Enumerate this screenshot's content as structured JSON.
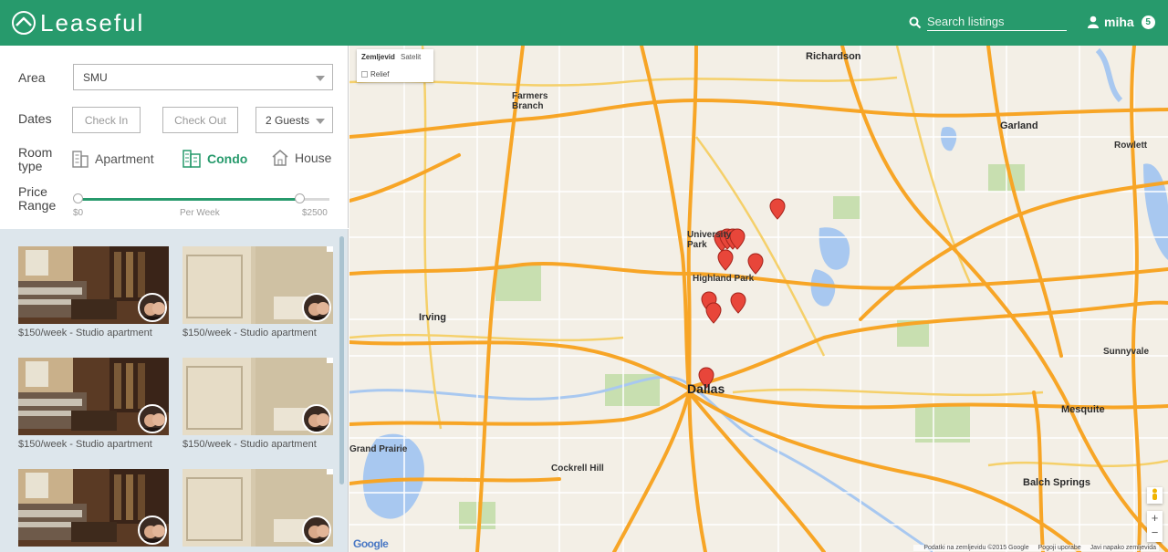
{
  "app": {
    "name": "Leaseful",
    "brand_color": "#279a6c"
  },
  "header": {
    "search_placeholder": "Search listings",
    "user_name": "miha",
    "notification_count": "5"
  },
  "filters": {
    "area_label": "Area",
    "area_value": "SMU",
    "dates_label": "Dates",
    "check_in_placeholder": "Check In",
    "check_out_placeholder": "Check Out",
    "guests_value": "2 Guests",
    "room_type_label": [
      "Room",
      "type"
    ],
    "room_types": [
      {
        "label": "Apartment",
        "icon": "building-icon",
        "selected": false
      },
      {
        "label": "Condo",
        "icon": "condo-icon",
        "selected": true
      },
      {
        "label": "House",
        "icon": "house-icon",
        "selected": false
      }
    ],
    "price_label": [
      "Price",
      "Range"
    ],
    "price_min": "$0",
    "price_unit": "Per Week",
    "price_max": "$2500",
    "price_selected_fraction": 0.88
  },
  "listings": [
    {
      "caption": "$150/week - Studio apartment",
      "photo": "bedroom"
    },
    {
      "caption": "$150/week - Studio apartment",
      "photo": "bathroom"
    },
    {
      "caption": "$150/week - Studio apartment",
      "photo": "bedroom"
    },
    {
      "caption": "$150/week - Studio apartment",
      "photo": "bathroom"
    },
    {
      "caption": "",
      "photo": "bedroom"
    },
    {
      "caption": "",
      "photo": "bathroom"
    }
  ],
  "map": {
    "type_map": "Zemljevid",
    "type_satellite": "Satelit",
    "relief": "Relief",
    "zoom_in": "+",
    "zoom_out": "−",
    "attribution": "Google",
    "footer_data": "Podatki na zemljevidu ©2015 Google",
    "footer_terms": "Pogoji uporabe",
    "footer_report": "Javi napako zemljevida",
    "cities": [
      {
        "name": "Dallas",
        "size": "big"
      },
      {
        "name": "Irving",
        "size": "mid"
      },
      {
        "name": "Garland",
        "size": "mid"
      },
      {
        "name": "Richardson",
        "size": "mid"
      },
      {
        "name": "Mesquite",
        "size": "mid"
      },
      {
        "name": "Farmers Branch",
        "size": "small"
      },
      {
        "name": "Highland Park",
        "size": "small"
      },
      {
        "name": "University Park",
        "size": "small"
      },
      {
        "name": "Balch Springs",
        "size": "small"
      },
      {
        "name": "Cockrell Hill",
        "size": "small"
      },
      {
        "name": "Grand Prairie",
        "size": "small"
      },
      {
        "name": "Rowlett",
        "size": "small"
      },
      {
        "name": "Sunnyvale",
        "size": "small"
      }
    ]
  }
}
